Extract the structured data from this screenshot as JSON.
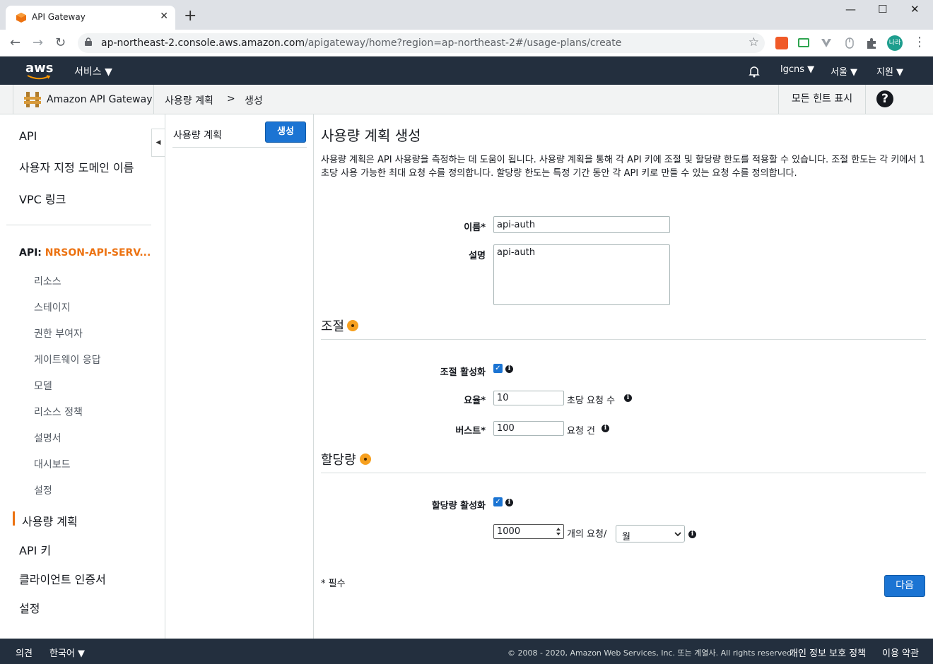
{
  "browser": {
    "tab_title": "API Gateway",
    "tab_close": "✕",
    "new_tab": "+",
    "window_controls": {
      "minimize": "—",
      "maximize": "☐",
      "close": "✕"
    },
    "url_host": "ap-northeast-2.console.aws.amazon.com",
    "url_path": "/apigateway/home?region=ap-northeast-2#/usage-plans/create",
    "nav": {
      "back": "←",
      "forward": "→",
      "reload": "↻"
    },
    "profile_avatar": "나라",
    "bookmark": "☆",
    "menu": "⋮"
  },
  "aws_header": {
    "logo": "aws",
    "services": "서비스 ▼",
    "account": "lgcns ▼",
    "region": "서울 ▼",
    "support": "지원 ▼"
  },
  "breadcrumb": {
    "service": "Amazon API Gateway",
    "item1": "사용량 계획",
    "sep": ">",
    "item2": "생성",
    "hints": "모든 힌트 표시",
    "help": "?"
  },
  "sidebar": {
    "top_items": [
      "API",
      "사용자 지정 도메인 이름",
      "VPC 링크"
    ],
    "api_prefix": "API: ",
    "api_name": "NRSON-API-SERV...",
    "sub_items": [
      "리소스",
      "스테이지",
      "권한 부여자",
      "게이트웨이 응답",
      "모델",
      "리소스 정책",
      "설명서",
      "대시보드",
      "설정"
    ],
    "bottom_items": [
      "사용량 계획",
      "API 키",
      "클라이언트 인증서",
      "설정"
    ]
  },
  "middle": {
    "label": "사용량 계획",
    "create_button": "생성",
    "collapse": "◀"
  },
  "main": {
    "title": "사용량 계획 생성",
    "description": "사용량 계획은 API 사용량을 측정하는 데 도움이 됩니다. 사용량 계획을 통해 각 API 키에 조절 및 할당량 한도를 적용할 수 있습니다. 조절 한도는 각 키에서 1초당 사용 가능한 최대 요청 수를 정의합니다. 할당량 한도는 특정 기간 동안 각 API 키로 만들 수 있는 요청 수를 정의합니다.",
    "name_label": "이름*",
    "name_value": "api-auth",
    "desc_label": "설명",
    "desc_value": "api-auth",
    "throttle_section": "조절",
    "throttle_enable_label": "조절 활성화",
    "throttle_enabled": true,
    "rate_label": "요율*",
    "rate_value": "10",
    "rate_suffix": "초당 요청 수",
    "burst_label": "버스트*",
    "burst_value": "100",
    "burst_suffix": "요청 건",
    "quota_section": "할당량",
    "quota_enable_label": "할당량 활성화",
    "quota_enabled": true,
    "quota_value": "1000",
    "quota_suffix": "개의 요청/",
    "quota_period": "월",
    "required_note": "* 필수",
    "next_button": "다음",
    "info_glyph": "i",
    "check_glyph": "✓"
  },
  "footer": {
    "feedback": "의견",
    "language": "한국어 ▼",
    "copyright": "© 2008 - 2020, Amazon Web Services, Inc. 또는 계열사. All rights reserved.",
    "privacy": "개인 정보 보호 정책",
    "terms": "이용 약관"
  },
  "colors": {
    "aws_dark": "#232f3e",
    "accent_orange": "#ec7211",
    "primary_blue": "#1b74d3"
  }
}
